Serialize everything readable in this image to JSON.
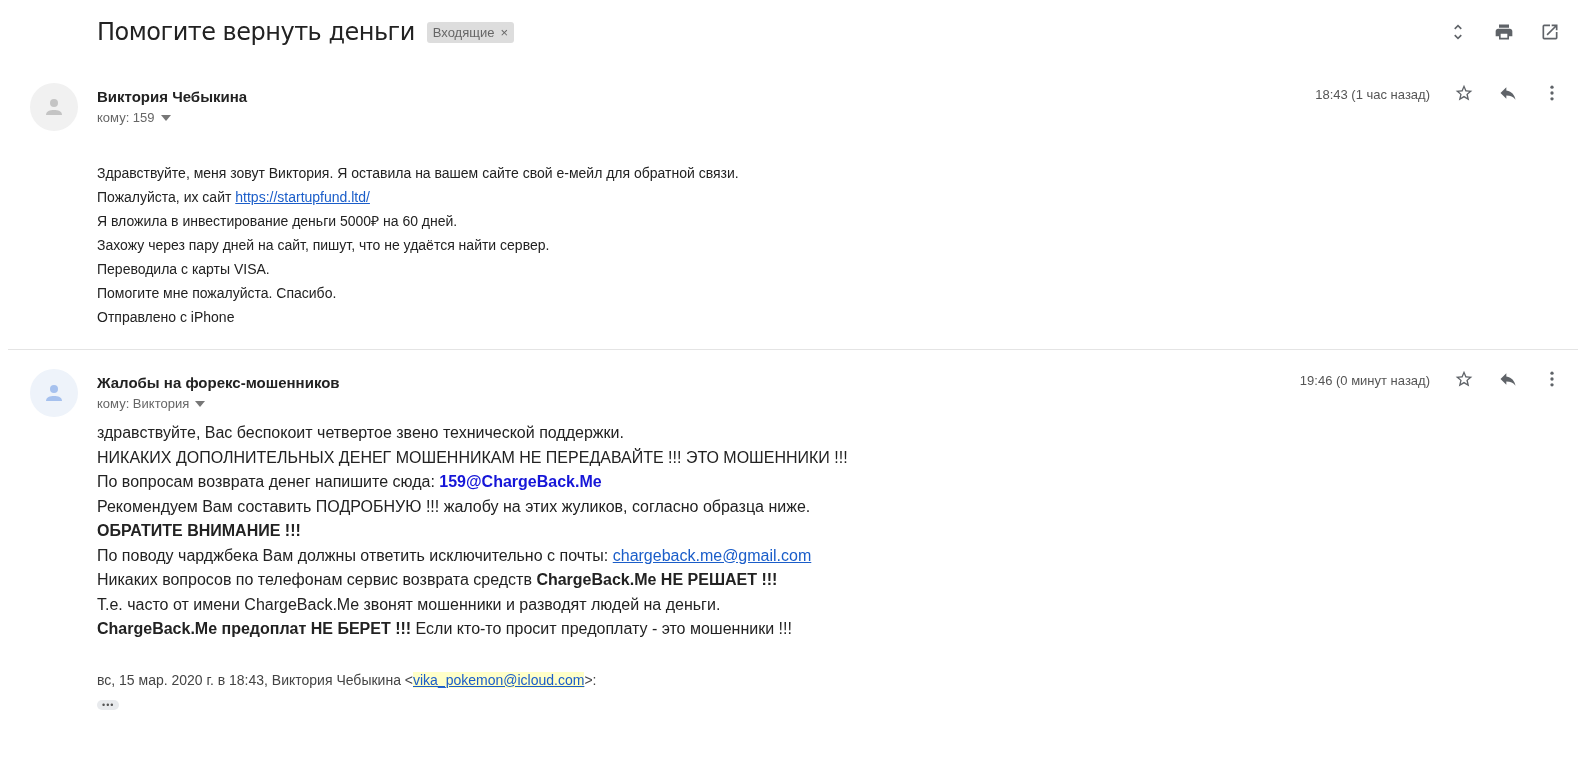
{
  "subject": "Помогите вернуть деньги",
  "label": {
    "text": "Входящие",
    "close": "×"
  },
  "messages": [
    {
      "sender": "Виктория Чебыкина",
      "to": "кому: 159",
      "time": "18:43 (1 час назад)",
      "starred": false,
      "kind": "original",
      "lines": [
        [
          {
            "kind": "text",
            "text": "Здравствуйте, меня зовут Виктория. Я оставила на вашем сайте свой е-мейл для обратной связи."
          }
        ],
        [
          {
            "kind": "text",
            "text": "Пожалуйста, их сайт "
          },
          {
            "kind": "link",
            "text": "https://startupfund.ltd/"
          }
        ],
        [
          {
            "kind": "text",
            "text": "Я вложила в инвестирование деньги 5000₽ на 60 дней."
          }
        ],
        [
          {
            "kind": "text",
            "text": "Захожу через пару дней на сайт, пишут, что не удаётся найти сервер."
          }
        ],
        [
          {
            "kind": "text",
            "text": "Переводила с карты VISA."
          }
        ],
        [
          {
            "kind": "text",
            "text": "Помогите мне пожалуйста. Спасибо."
          }
        ],
        [
          {
            "kind": "text",
            "text": "Отправлено с iPhone"
          }
        ]
      ]
    },
    {
      "sender": "Жалобы на форекс-мошенников",
      "to": "кому: Виктория",
      "time": "19:46 (0 минут назад)",
      "starred": false,
      "kind": "reply",
      "lines": [
        [
          {
            "kind": "text",
            "text": "здравствуйте, Вас беспокоит четвертое звено технической поддержки."
          }
        ],
        [
          {
            "kind": "text",
            "text": "НИКАКИХ ДОПОЛНИТЕЛЬНЫХ ДЕНЕГ МОШЕННИКАМ НЕ ПЕРЕДАВАЙТЕ !!! ЭТО МОШЕННИКИ !!!"
          }
        ],
        [
          {
            "kind": "text",
            "text": "По вопросам возврата денег напишите сюда: "
          },
          {
            "kind": "accent",
            "text": "159@ChargeBack.Me"
          }
        ],
        [
          {
            "kind": "text",
            "text": "Рекомендуем Вам составить ПОДРОБНУЮ !!! жалобу на этих жуликов, согласно образца ниже."
          }
        ],
        [
          {
            "kind": "bold",
            "text": "ОБРАТИТЕ ВНИМАНИЕ !!!"
          }
        ],
        [
          {
            "kind": "text",
            "text": "По поводу чарджбека Вам должны ответить исключительно с почты: "
          },
          {
            "kind": "link",
            "text": "chargeback.me@gmail.com"
          }
        ],
        [
          {
            "kind": "text",
            "text": "Никаких вопросов по телефонам сервис возврата средств "
          },
          {
            "kind": "bold",
            "text": "ChargeBack.Me НЕ РЕШАЕТ !!!"
          }
        ],
        [
          {
            "kind": "text",
            "text": "Т.е. часто от имени ChargeBack.Me звонят мошенники и разводят людей на деньги."
          }
        ],
        [
          {
            "kind": "bold",
            "text": "ChargeBack.Me предоплат НЕ БЕРЕТ !!!"
          },
          {
            "kind": "text",
            "text": " Если кто-то просит предоплату - это мошенники !!!"
          }
        ]
      ],
      "quote": [
        {
          "kind": "text",
          "text": "вс, 15 мар. 2020 г. в 18:43, Виктория Чебыкина <"
        },
        {
          "kind": "mark_link",
          "text": "vika_pokemon@icloud.com"
        },
        {
          "kind": "text",
          "text": ">:"
        }
      ],
      "trimmed": "•••"
    }
  ]
}
